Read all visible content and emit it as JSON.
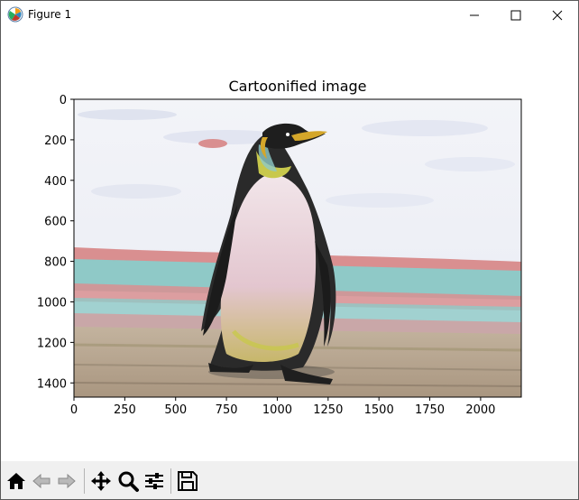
{
  "window": {
    "title": "Figure 1",
    "controls": [
      "minimize-icon",
      "maximize-icon",
      "close-icon"
    ]
  },
  "chart_data": {
    "type": "image",
    "title": "Cartoonified image",
    "xlabel": "",
    "ylabel": "",
    "xlim": [
      0,
      2200
    ],
    "ylim": [
      1470,
      0
    ],
    "xticks": [
      "0",
      "250",
      "500",
      "750",
      "1000",
      "1250",
      "1500",
      "1750",
      "2000"
    ],
    "yticks": [
      "0",
      "200",
      "400",
      "600",
      "800",
      "1000",
      "1200",
      "1400"
    ],
    "image_description": "cartoon-filtered king penguin on a sandy beach with teal and pink shoreline bands"
  },
  "toolbar": {
    "buttons": [
      "home-icon",
      "back-icon",
      "forward-icon",
      "pan-icon",
      "zoom-icon",
      "configure-subplots-icon",
      "save-icon"
    ]
  },
  "colors": {
    "toolbar_bg": "#f0f0f0",
    "sky": "#eef0f6",
    "shore_pink": "#d98f90",
    "shore_teal": "#8fc9c7",
    "sand": "#b8a48c",
    "penguin_dark": "#2a2a2a",
    "penguin_belly": "#e6cdd3",
    "beak_yellow": "#d4a62a"
  }
}
